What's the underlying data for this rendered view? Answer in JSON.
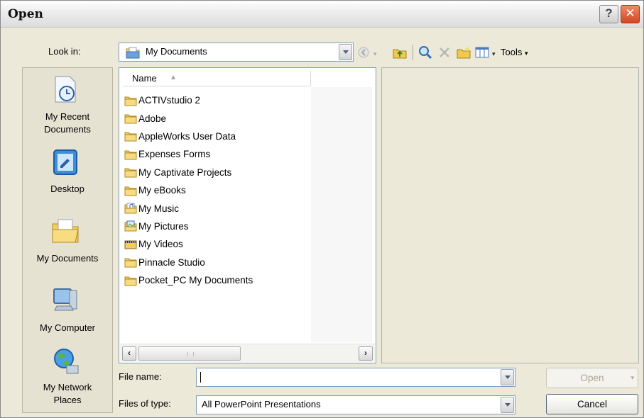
{
  "window": {
    "title": "Open",
    "help_glyph": "?",
    "close_glyph": "✕"
  },
  "look_in": {
    "label": "Look in:",
    "value": "My Documents"
  },
  "toolbar": {
    "tools_label": "Tools"
  },
  "places": [
    {
      "label": "My Recent\nDocuments",
      "icon": "recent-documents-icon"
    },
    {
      "label": "Desktop",
      "icon": "desktop-icon"
    },
    {
      "label": "My Documents",
      "icon": "my-documents-icon"
    },
    {
      "label": "My Computer",
      "icon": "my-computer-icon"
    },
    {
      "label": "My Network\nPlaces",
      "icon": "network-places-icon"
    }
  ],
  "file_list": {
    "column_name": "Name",
    "items": [
      {
        "name": "ACTIVstudio 2",
        "icon": "folder-icon"
      },
      {
        "name": "Adobe",
        "icon": "folder-icon"
      },
      {
        "name": "AppleWorks User Data",
        "icon": "folder-icon"
      },
      {
        "name": "Expenses Forms",
        "icon": "folder-icon"
      },
      {
        "name": "My Captivate Projects",
        "icon": "folder-icon"
      },
      {
        "name": "My eBooks",
        "icon": "folder-icon"
      },
      {
        "name": "My Music",
        "icon": "music-folder-icon"
      },
      {
        "name": "My Pictures",
        "icon": "pictures-folder-icon"
      },
      {
        "name": "My Videos",
        "icon": "videos-folder-icon"
      },
      {
        "name": "Pinnacle Studio",
        "icon": "folder-icon"
      },
      {
        "name": "Pocket_PC My Documents",
        "icon": "folder-icon"
      }
    ]
  },
  "file_name": {
    "label": "File name:",
    "value": ""
  },
  "file_type": {
    "label": "Files of type:",
    "value": "All PowerPoint Presentations"
  },
  "buttons": {
    "open": "Open",
    "cancel": "Cancel"
  },
  "colors": {
    "dialog_bg": "#ece9d8",
    "field_border": "#7f9db9",
    "close_red": "#d3471f"
  }
}
